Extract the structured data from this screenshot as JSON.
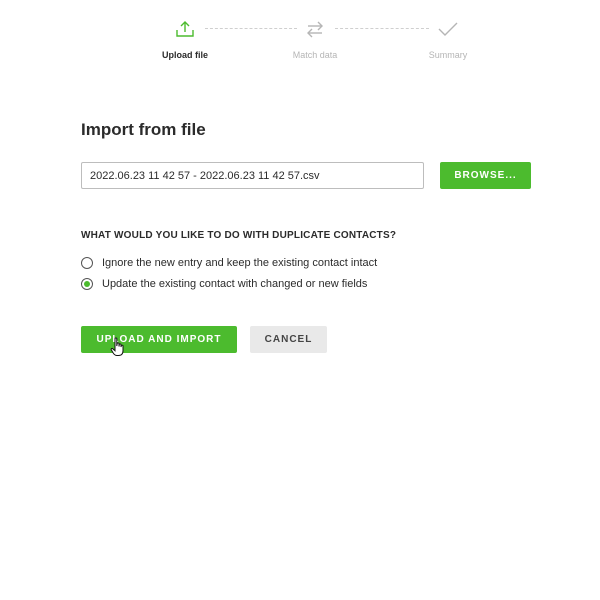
{
  "stepper": {
    "steps": [
      {
        "label": "Upload file",
        "icon": "upload-icon",
        "active": true
      },
      {
        "label": "Match data",
        "icon": "swap-arrows-icon",
        "active": false
      },
      {
        "label": "Summary",
        "icon": "checkmark-icon",
        "active": false
      }
    ]
  },
  "main": {
    "title": "Import from file",
    "file_value": "2022.06.23 11 42 57 - 2022.06.23 11 42 57.csv",
    "browse_label": "BROWSE...",
    "duplicates_question": "WHAT WOULD YOU LIKE TO DO WITH DUPLICATE CONTACTS?",
    "options": [
      {
        "label": "Ignore the new entry and keep the existing contact intact",
        "selected": false
      },
      {
        "label": "Update the existing contact with changed or new fields",
        "selected": true
      }
    ],
    "upload_label": "UPLOAD AND IMPORT",
    "cancel_label": "CANCEL"
  },
  "colors": {
    "accent": "#4cbb2e",
    "muted": "#b5b5b5",
    "cancel_bg": "#e9e9e9"
  }
}
